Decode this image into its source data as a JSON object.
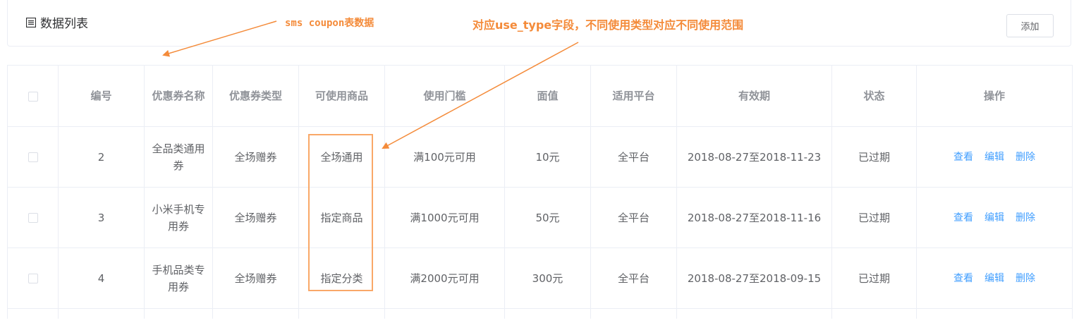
{
  "toolbar": {
    "title": "数据列表",
    "title_icon": "list-icon",
    "add_label": "添加"
  },
  "annotations": {
    "table_note": "sms coupon表数据",
    "field_note": "对应use_type字段，不同使用类型对应不同使用范围",
    "color": "#f48b3a"
  },
  "table": {
    "headers": [
      "",
      "编号",
      "优惠券名称",
      "优惠券类型",
      "可使用商品",
      "使用门槛",
      "面值",
      "适用平台",
      "有效期",
      "状态",
      "操作"
    ],
    "rows": [
      {
        "id": "2",
        "name": "全品类通用券",
        "type": "全场赠券",
        "goods": "全场通用",
        "threshold": "满100元可用",
        "amount": "10元",
        "platform": "全平台",
        "period": "2018-08-27至2018-11-23",
        "status": "已过期"
      },
      {
        "id": "3",
        "name": "小米手机专用券",
        "type": "全场赠券",
        "goods": "指定商品",
        "threshold": "满1000元可用",
        "amount": "50元",
        "platform": "全平台",
        "period": "2018-08-27至2018-11-16",
        "status": "已过期"
      },
      {
        "id": "4",
        "name": "手机品类专用券",
        "type": "全场赠券",
        "goods": "指定分类",
        "threshold": "满2000元可用",
        "amount": "300元",
        "platform": "全平台",
        "period": "2018-08-27至2018-09-15",
        "status": "已过期"
      }
    ],
    "actions": {
      "view": "查看",
      "edit": "编辑",
      "delete": "删除"
    }
  },
  "colors": {
    "link": "#409eff",
    "border": "#ebeef5",
    "header_text": "#909399",
    "annotation": "#f48b3a"
  }
}
